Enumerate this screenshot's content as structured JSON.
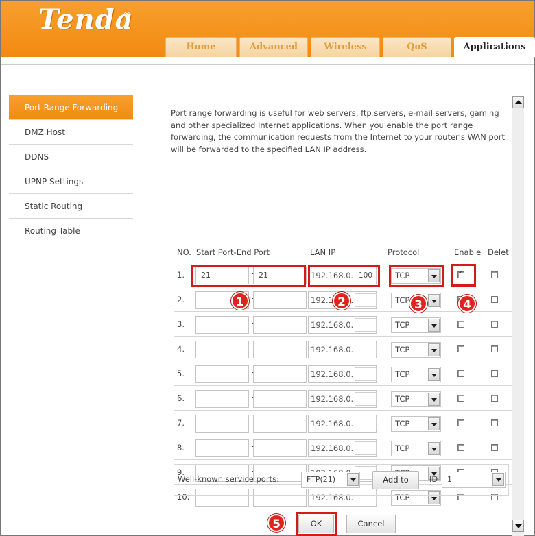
{
  "header": {
    "logo": "Tenda",
    "tabs": [
      "Home",
      "Advanced",
      "Wireless",
      "QoS",
      "Applications"
    ],
    "active_tab": "Applications",
    "brand_color": "#f28a10"
  },
  "sidebar": {
    "items": [
      {
        "label": "Port Range Forwarding",
        "active": true
      },
      {
        "label": "DMZ Host",
        "active": false
      },
      {
        "label": "DDNS",
        "active": false
      },
      {
        "label": "UPNP Settings",
        "active": false
      },
      {
        "label": "Static Routing",
        "active": false
      },
      {
        "label": "Routing Table",
        "active": false
      }
    ]
  },
  "main": {
    "description": "Port range forwarding is useful for web servers, ftp servers, e-mail servers, gaming and other specialized Internet applications. When you enable the port range forwarding, the communication requests from the Internet to your router's WAN port will be forwarded to the specified LAN IP address.",
    "columns": {
      "no": "NO.",
      "ports": "Start Port-End Port",
      "lan_ip": "LAN IP",
      "protocol": "Protocol",
      "enable": "Enable",
      "delete": "Delet"
    },
    "rows": [
      {
        "no": "1.",
        "start": "21",
        "end": "21",
        "ip_prefix": "192.168.0.",
        "ip_last": "100",
        "protocol": "TCP",
        "enabled": true
      },
      {
        "no": "2.",
        "start": "",
        "end": "",
        "ip_prefix": "192.168.0.",
        "ip_last": "",
        "protocol": "TCP",
        "enabled": false
      },
      {
        "no": "3.",
        "start": "",
        "end": "",
        "ip_prefix": "192.168.0.",
        "ip_last": "",
        "protocol": "TCP",
        "enabled": false
      },
      {
        "no": "4.",
        "start": "",
        "end": "",
        "ip_prefix": "192.168.0.",
        "ip_last": "",
        "protocol": "TCP",
        "enabled": false
      },
      {
        "no": "5.",
        "start": "",
        "end": "",
        "ip_prefix": "192.168.0.",
        "ip_last": "",
        "protocol": "TCP",
        "enabled": false
      },
      {
        "no": "6.",
        "start": "",
        "end": "",
        "ip_prefix": "192.168.0.",
        "ip_last": "",
        "protocol": "TCP",
        "enabled": false
      },
      {
        "no": "7.",
        "start": "",
        "end": "",
        "ip_prefix": "192.168.0.",
        "ip_last": "",
        "protocol": "TCP",
        "enabled": false
      },
      {
        "no": "8.",
        "start": "",
        "end": "",
        "ip_prefix": "192.168.0.",
        "ip_last": "",
        "protocol": "TCP",
        "enabled": false
      },
      {
        "no": "9.",
        "start": "",
        "end": "",
        "ip_prefix": "192.168.0.",
        "ip_last": "",
        "protocol": "TCP",
        "enabled": false
      },
      {
        "no": "10.",
        "start": "",
        "end": "",
        "ip_prefix": "192.168.0.",
        "ip_last": "",
        "protocol": "TCP",
        "enabled": false
      }
    ],
    "well_known": {
      "label": "Well-known service ports:",
      "service": "FTP(21)",
      "add_button": "Add to",
      "id_label": "ID",
      "id_value": "1"
    },
    "ok_button": "OK",
    "cancel_button": "Cancel"
  },
  "callouts": [
    "1",
    "2",
    "3",
    "4",
    "5"
  ],
  "callout_color": "#d61a1a"
}
